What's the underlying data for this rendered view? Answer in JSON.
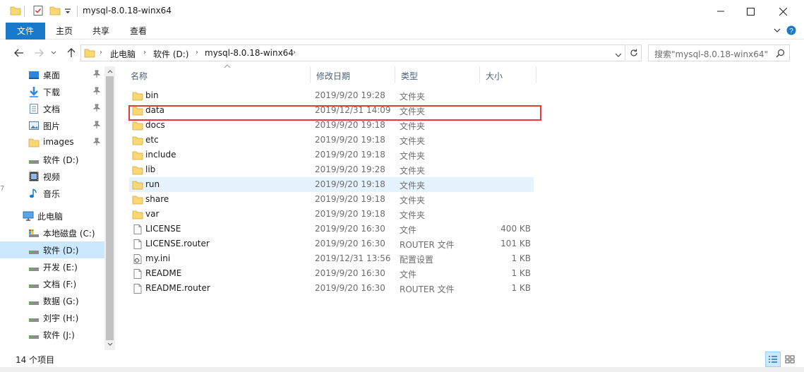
{
  "window": {
    "title": "mysql-8.0.18-winx64",
    "minimize_icon": "minimize-icon",
    "maximize_icon": "maximize-icon",
    "close_icon": "close-icon"
  },
  "ribbon": {
    "tabs": [
      "文件",
      "主页",
      "共享",
      "查看"
    ]
  },
  "address": {
    "crumbs": [
      "此电脑",
      "软件 (D:)",
      "mysql-8.0.18-winx64"
    ],
    "search_placeholder": "搜索\"mysql-8.0.18-winx64\""
  },
  "sidebar": {
    "quick_access": [
      {
        "label": "桌面",
        "icon": "desktop-icon",
        "pinned": true
      },
      {
        "label": "下载",
        "icon": "download-icon",
        "pinned": true
      },
      {
        "label": "文档",
        "icon": "document-icon",
        "pinned": true
      },
      {
        "label": "图片",
        "icon": "picture-icon",
        "pinned": true
      },
      {
        "label": "images",
        "icon": "folder-icon",
        "pinned": true
      },
      {
        "label": "软件 (D:)",
        "icon": "drive-icon",
        "pinned": false
      },
      {
        "label": "视频",
        "icon": "video-icon",
        "pinned": false
      },
      {
        "label": "音乐",
        "icon": "music-icon",
        "pinned": false
      }
    ],
    "this_pc": "此电脑",
    "drives": [
      {
        "label": "本地磁盘 (C:)",
        "selected": false
      },
      {
        "label": "软件 (D:)",
        "selected": true
      },
      {
        "label": "开发 (E:)",
        "selected": false
      },
      {
        "label": "文档 (F:)",
        "selected": false
      },
      {
        "label": "数据 (G:)",
        "selected": false
      },
      {
        "label": "刘宇 (H:)",
        "selected": false
      },
      {
        "label": "软件 (J:)",
        "selected": false
      }
    ]
  },
  "columns": {
    "name": "名称",
    "date": "修改日期",
    "type": "类型",
    "size": "大小"
  },
  "files": [
    {
      "name": "bin",
      "date": "2019/9/20 19:28",
      "type": "文件夹",
      "size": "",
      "kind": "folder"
    },
    {
      "name": "data",
      "date": "2019/12/31 14:09",
      "type": "文件夹",
      "size": "",
      "kind": "folder"
    },
    {
      "name": "docs",
      "date": "2019/9/20 19:18",
      "type": "文件夹",
      "size": "",
      "kind": "folder"
    },
    {
      "name": "etc",
      "date": "2019/9/20 19:18",
      "type": "文件夹",
      "size": "",
      "kind": "folder"
    },
    {
      "name": "include",
      "date": "2019/9/20 19:18",
      "type": "文件夹",
      "size": "",
      "kind": "folder"
    },
    {
      "name": "lib",
      "date": "2019/9/20 19:28",
      "type": "文件夹",
      "size": "",
      "kind": "folder"
    },
    {
      "name": "run",
      "date": "2019/9/20 19:18",
      "type": "文件夹",
      "size": "",
      "kind": "folder"
    },
    {
      "name": "share",
      "date": "2019/9/20 19:18",
      "type": "文件夹",
      "size": "",
      "kind": "folder"
    },
    {
      "name": "var",
      "date": "2019/9/20 19:18",
      "type": "文件夹",
      "size": "",
      "kind": "folder"
    },
    {
      "name": "LICENSE",
      "date": "2019/9/20 16:30",
      "type": "文件",
      "size": "400 KB",
      "kind": "file"
    },
    {
      "name": "LICENSE.router",
      "date": "2019/9/20 16:30",
      "type": "ROUTER 文件",
      "size": "101 KB",
      "kind": "file"
    },
    {
      "name": "my.ini",
      "date": "2019/12/31 13:56",
      "type": "配置设置",
      "size": "1 KB",
      "kind": "ini"
    },
    {
      "name": "README",
      "date": "2019/9/20 16:30",
      "type": "文件",
      "size": "1 KB",
      "kind": "file"
    },
    {
      "name": "README.router",
      "date": "2019/9/20 16:30",
      "type": "ROUTER 文件",
      "size": "1 KB",
      "kind": "file"
    }
  ],
  "status": {
    "count": "14 个项目"
  },
  "colors": {
    "accent": "#1979ca",
    "selection": "#cce8ff",
    "hover": "#e5f3ff",
    "folder": "#f8d775",
    "highlight_box": "#e33a3a"
  }
}
